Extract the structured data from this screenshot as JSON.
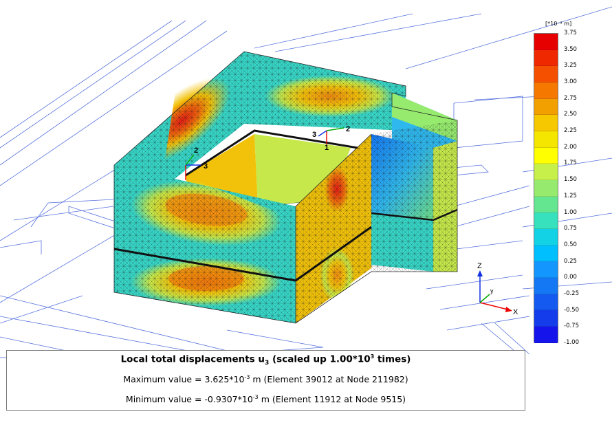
{
  "plot": {
    "local_axis_labels": {
      "one": "1",
      "two": "2",
      "three": "3"
    },
    "global_axes": {
      "x": "X",
      "y": "y",
      "z": "Z"
    }
  },
  "legend": {
    "unit": "[*10⁻³ m]",
    "ticks": [
      "3.75",
      "3.50",
      "3.25",
      "3.00",
      "2.75",
      "2.50",
      "2.25",
      "2.00",
      "1.75",
      "1.50",
      "1.25",
      "1.00",
      "0.75",
      "0.50",
      "0.25",
      "0.00",
      "-0.25",
      "-0.50",
      "-0.75",
      "-1.00"
    ],
    "colors": [
      "#e60000",
      "#f02800",
      "#f55000",
      "#f57800",
      "#f2a000",
      "#f5c800",
      "#f5e600",
      "#ffff00",
      "#c8f04a",
      "#96eb6e",
      "#64e691",
      "#37e1be",
      "#14d2e6",
      "#00bfff",
      "#1496ff",
      "#1478f5",
      "#145af0",
      "#143ceb",
      "#1414eb"
    ]
  },
  "info": {
    "title_main": "Local total displacements u",
    "title_sub": "3",
    "title_rest": " (scaled up 1.00*10",
    "title_exp": "3",
    "title_end": " times)",
    "max_pre": "Maximum value = 3.625*10",
    "max_exp": "-3",
    "max_post": " m (Element 39012 at Node 211982)",
    "min_pre": "Minimum value = -0.9307*10",
    "min_exp": "-3",
    "min_post": " m (Element 11912 at Node 9515)"
  }
}
